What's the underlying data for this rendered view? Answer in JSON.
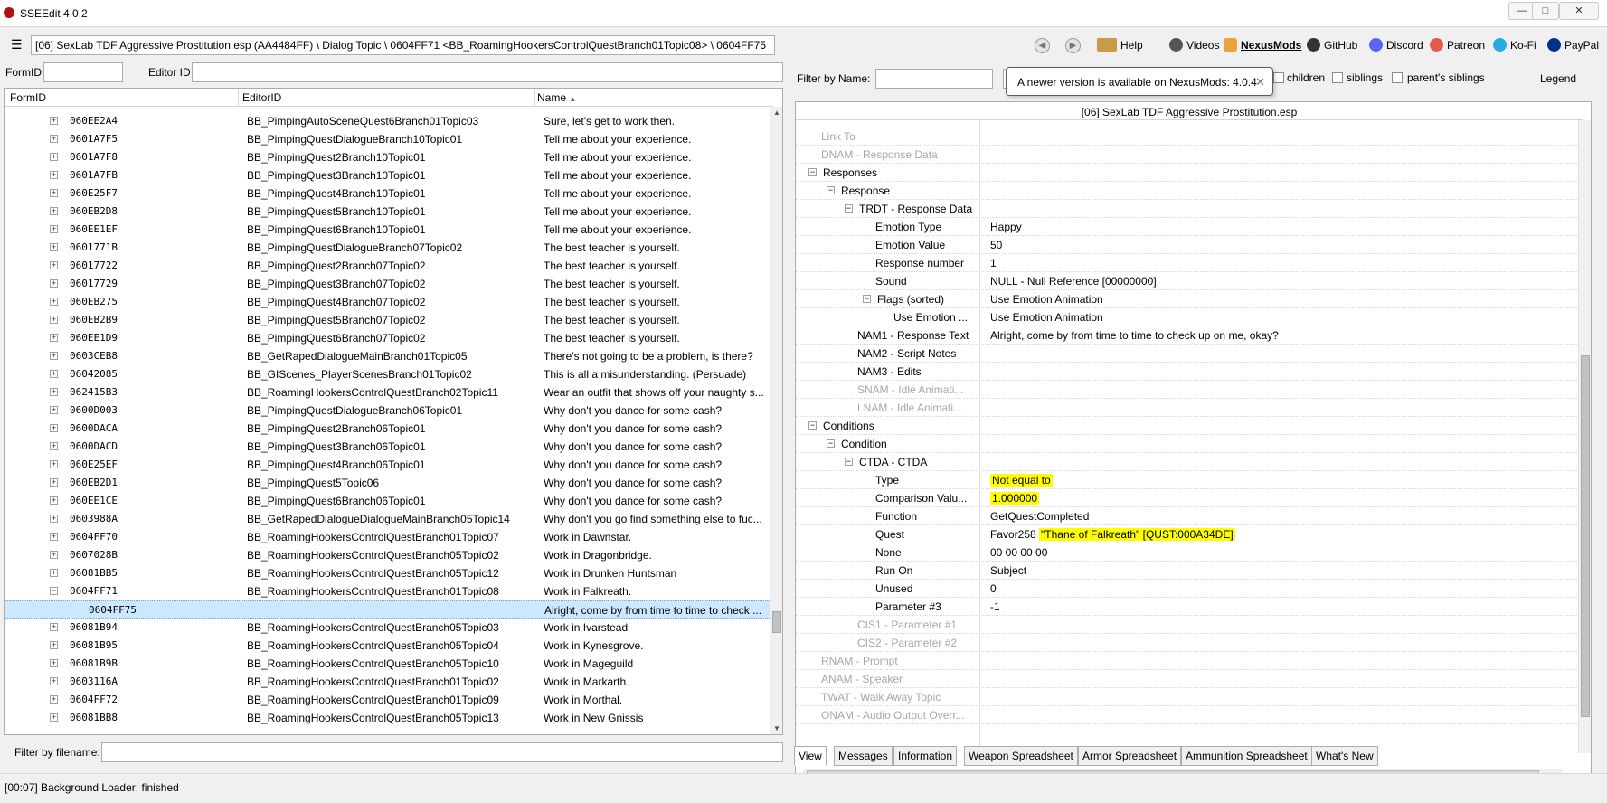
{
  "window": {
    "title": "SSEEdit 4.0.2",
    "min": "—",
    "max": "□",
    "close": "✕"
  },
  "toolbar": {
    "menu_icon": "hamburger-icon",
    "path": "[06] SexLab TDF Aggressive Prostitution.esp (AA4484FF) \\ Dialog Topic \\ 0604FF71 <BB_RoamingHookersControlQuestBranch01Topic08> \\ 0604FF75",
    "back_icon": "arrow-left-icon",
    "forward_icon": "arrow-right-icon",
    "help": "Help",
    "videos": "Videos",
    "nexusmods": "NexusMods",
    "github": "GitHub",
    "discord": "Discord",
    "patreon": "Patreon",
    "kofi": "Ko-Fi",
    "paypal": "PayPal"
  },
  "left": {
    "formid_label": "FormID",
    "editorid_label": "Editor ID",
    "columns": {
      "formid": "FormID",
      "editorid": "EditorID",
      "name": "Name"
    },
    "filename_label": "Filter by filename:",
    "rows": [
      {
        "fid": "060EE2A4",
        "eid": "BB_PimpingAutoSceneQuest6Branch01Topic03",
        "name": "Sure, let's get to work then."
      },
      {
        "fid": "0601A7F5",
        "eid": "BB_PimpingQuestDialogueBranch10Topic01",
        "name": "Tell me about your experience."
      },
      {
        "fid": "0601A7F8",
        "eid": "BB_PimpingQuest2Branch10Topic01",
        "name": "Tell me about your experience."
      },
      {
        "fid": "0601A7FB",
        "eid": "BB_PimpingQuest3Branch10Topic01",
        "name": "Tell me about your experience."
      },
      {
        "fid": "060E25F7",
        "eid": "BB_PimpingQuest4Branch10Topic01",
        "name": "Tell me about your experience."
      },
      {
        "fid": "060EB2D8",
        "eid": "BB_PimpingQuest5Branch10Topic01",
        "name": "Tell me about your experience."
      },
      {
        "fid": "060EE1EF",
        "eid": "BB_PimpingQuest6Branch10Topic01",
        "name": "Tell me about your experience."
      },
      {
        "fid": "0601771B",
        "eid": "BB_PimpingQuestDialogueBranch07Topic02",
        "name": "The best teacher is yourself."
      },
      {
        "fid": "06017722",
        "eid": "BB_PimpingQuest2Branch07Topic02",
        "name": "The best teacher is yourself."
      },
      {
        "fid": "06017729",
        "eid": "BB_PimpingQuest3Branch07Topic02",
        "name": "The best teacher is yourself."
      },
      {
        "fid": "060EB275",
        "eid": "BB_PimpingQuest4Branch07Topic02",
        "name": "The best teacher is yourself."
      },
      {
        "fid": "060EB2B9",
        "eid": "BB_PimpingQuest5Branch07Topic02",
        "name": "The best teacher is yourself."
      },
      {
        "fid": "060EE1D9",
        "eid": "BB_PimpingQuest6Branch07Topic02",
        "name": "The best teacher is yourself."
      },
      {
        "fid": "0603CEB8",
        "eid": "BB_GetRapedDialogueMainBranch01Topic05",
        "name": "There's not going to be a problem, is there?"
      },
      {
        "fid": "06042085",
        "eid": "BB_GIScenes_PlayerScenesBranch01Topic02",
        "name": "This is all a misunderstanding. (Persuade)"
      },
      {
        "fid": "062415B3",
        "eid": "BB_RoamingHookersControlQuestBranch02Topic11",
        "name": "Wear an outfit that shows off your naughty s..."
      },
      {
        "fid": "0600D003",
        "eid": "BB_PimpingQuestDialogueBranch06Topic01",
        "name": "Why don't you dance for some cash?"
      },
      {
        "fid": "0600DACA",
        "eid": "BB_PimpingQuest2Branch06Topic01",
        "name": "Why don't you dance for some cash?"
      },
      {
        "fid": "0600DACD",
        "eid": "BB_PimpingQuest3Branch06Topic01",
        "name": "Why don't you dance for some cash?"
      },
      {
        "fid": "060E25EF",
        "eid": "BB_PimpingQuest4Branch06Topic01",
        "name": "Why don't you dance for some cash?"
      },
      {
        "fid": "060EB2D1",
        "eid": "BB_PimpingQuest5Topic06",
        "name": "Why don't you dance for some cash?"
      },
      {
        "fid": "060EE1CE",
        "eid": "BB_PimpingQuest6Branch06Topic01",
        "name": "Why don't you dance for some cash?"
      },
      {
        "fid": "0603988A",
        "eid": "BB_GetRapedDialogueDialogueMainBranch05Topic14",
        "name": "Why don't you go find something else to fuc..."
      },
      {
        "fid": "0604FF70",
        "eid": "BB_RoamingHookersControlQuestBranch01Topic07",
        "name": "Work in Dawnstar."
      },
      {
        "fid": "0607028B",
        "eid": "BB_RoamingHookersControlQuestBranch05Topic02",
        "name": "Work in Dragonbridge."
      },
      {
        "fid": "06081BB5",
        "eid": "BB_RoamingHookersControlQuestBranch05Topic12",
        "name": "Work in Drunken Huntsman"
      },
      {
        "fid": "0604FF71",
        "eid": "BB_RoamingHookersControlQuestBranch01Topic08",
        "name": "Work in Falkreath."
      },
      {
        "fid": "0604FF75",
        "eid": "",
        "name": "Alright, come by from time to time to check ..."
      },
      {
        "fid": "06081B94",
        "eid": "BB_RoamingHookersControlQuestBranch05Topic03",
        "name": "Work in Ivarstead"
      },
      {
        "fid": "06081B95",
        "eid": "BB_RoamingHookersControlQuestBranch05Topic04",
        "name": "Work in Kynesgrove."
      },
      {
        "fid": "06081B9B",
        "eid": "BB_RoamingHookersControlQuestBranch05Topic10",
        "name": "Work in Mageguild"
      },
      {
        "fid": "0603116A",
        "eid": "BB_RoamingHookersControlQuestBranch01Topic02",
        "name": "Work in Markarth."
      },
      {
        "fid": "0604FF72",
        "eid": "BB_RoamingHookersControlQuestBranch01Topic09",
        "name": "Work in Morthal."
      },
      {
        "fid": "06081BB8",
        "eid": "BB_RoamingHookersControlQuestBranch05Topic13",
        "name": "Work in New Gnissis"
      }
    ]
  },
  "right": {
    "filter_label": "Filter by Name:",
    "children": "children",
    "siblings": "siblings",
    "parents_siblings": "parent's siblings",
    "legend": "Legend",
    "tooltip": "A newer version is available on NexusMods: 4.0.4",
    "header": "[06] SexLab TDF Aggressive Prostitution.esp",
    "rows": [
      {
        "label": "Link To",
        "value": "",
        "grey": true
      },
      {
        "label": "DNAM - Response Data",
        "value": "",
        "grey": true
      },
      {
        "label": "Responses",
        "value": ""
      },
      {
        "label": "Response",
        "value": ""
      },
      {
        "label": "TRDT - Response Data",
        "value": ""
      },
      {
        "label": "Emotion Type",
        "value": "Happy"
      },
      {
        "label": "Emotion Value",
        "value": "50"
      },
      {
        "label": "Response number",
        "value": "1"
      },
      {
        "label": "Sound",
        "value": "NULL - Null Reference [00000000]"
      },
      {
        "label": "Flags (sorted)",
        "value": "Use Emotion Animation"
      },
      {
        "label": "Use Emotion ...",
        "value": "Use Emotion Animation"
      },
      {
        "label": "NAM1 - Response Text",
        "value": "Alright, come by from time to time to check up on me, okay?"
      },
      {
        "label": "NAM2 - Script Notes",
        "value": ""
      },
      {
        "label": "NAM3 - Edits",
        "value": ""
      },
      {
        "label": "SNAM - Idle Animati...",
        "value": "",
        "grey": true
      },
      {
        "label": "LNAM - Idle Animati...",
        "value": "",
        "grey": true
      },
      {
        "label": "Conditions",
        "value": ""
      },
      {
        "label": "Condition",
        "value": ""
      },
      {
        "label": "CTDA - CTDA",
        "value": ""
      },
      {
        "label": "Type",
        "value": "Not equal to",
        "highlight": true
      },
      {
        "label": "Comparison Valu...",
        "value": "1.000000",
        "highlight": true
      },
      {
        "label": "Function",
        "value": "GetQuestCompleted"
      },
      {
        "label": "Quest",
        "value_prefix": "Favor258 ",
        "value": "\"Thane of Falkreath\" [QUST:000A34DE]",
        "highlight": true
      },
      {
        "label": "None",
        "value": "00 00 00 00"
      },
      {
        "label": "Run On",
        "value": "Subject"
      },
      {
        "label": "Unused",
        "value": "0"
      },
      {
        "label": "Parameter #3",
        "value": "-1"
      },
      {
        "label": "CIS1 - Parameter #1",
        "value": "",
        "grey": true
      },
      {
        "label": "CIS2 - Parameter #2",
        "value": "",
        "grey": true
      },
      {
        "label": "RNAM - Prompt",
        "value": "",
        "grey": true
      },
      {
        "label": "ANAM - Speaker",
        "value": "",
        "grey": true
      },
      {
        "label": "TWAT - Walk Away Topic",
        "value": "",
        "grey": true
      },
      {
        "label": "ONAM - Audio Output Overr...",
        "value": "",
        "grey": true
      }
    ]
  },
  "tabs": [
    "View",
    "Messages",
    "Information",
    "Weapon Spreadsheet",
    "Armor Spreadsheet",
    "Ammunition Spreadsheet",
    "What's New"
  ],
  "status": "[00:07] Background Loader: finished",
  "colors": {
    "selection": "#cce8ff",
    "highlight": "#ffff00",
    "grey_label": "#a7a7a7"
  }
}
